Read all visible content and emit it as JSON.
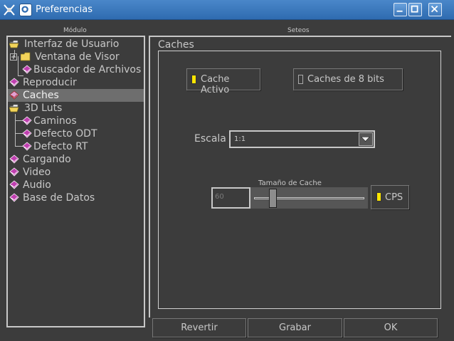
{
  "window": {
    "title": "Preferencias"
  },
  "headers": {
    "module": "Módulo",
    "settings": "Seteos"
  },
  "tree": {
    "items": [
      {
        "label": "Interfaz de Usuario",
        "icon": "open-folder-icon"
      },
      {
        "label": "Ventana de Visor",
        "icon": "folder-icon",
        "expandable": true
      },
      {
        "label": "Buscador de Archivos",
        "icon": "book-icon"
      },
      {
        "label": "Reproducir",
        "icon": "book-icon"
      },
      {
        "label": "Caches",
        "icon": "book-icon",
        "selected": true
      },
      {
        "label": "3D Luts",
        "icon": "open-folder-icon"
      },
      {
        "label": "Caminos",
        "icon": "book-icon"
      },
      {
        "label": "Defecto ODT",
        "icon": "book-icon"
      },
      {
        "label": "Defecto RT",
        "icon": "book-icon"
      },
      {
        "label": "Cargando",
        "icon": "book-icon"
      },
      {
        "label": "Video",
        "icon": "book-icon"
      },
      {
        "label": "Audio",
        "icon": "book-icon"
      },
      {
        "label": "Base de Datos",
        "icon": "book-icon"
      }
    ]
  },
  "caches": {
    "group_title": "Caches",
    "cache_active": {
      "label": "Cache Activo",
      "checked": true
    },
    "caches_8bit": {
      "label": "Caches de 8 bits",
      "checked": false
    },
    "scale": {
      "label": "Escala",
      "value": "1:1"
    },
    "cache_size": {
      "label": "Tamaño de Cache",
      "value": "60",
      "slider_fraction": 0.17
    },
    "cps": {
      "label": "CPS",
      "checked": true
    }
  },
  "buttons": {
    "revert": "Revertir",
    "save": "Grabar",
    "ok": "OK"
  },
  "colors": {
    "titlebar": "#3a78bd",
    "background": "#3c3c3c",
    "check_on": "#ffe600",
    "book": "#c040b0"
  }
}
